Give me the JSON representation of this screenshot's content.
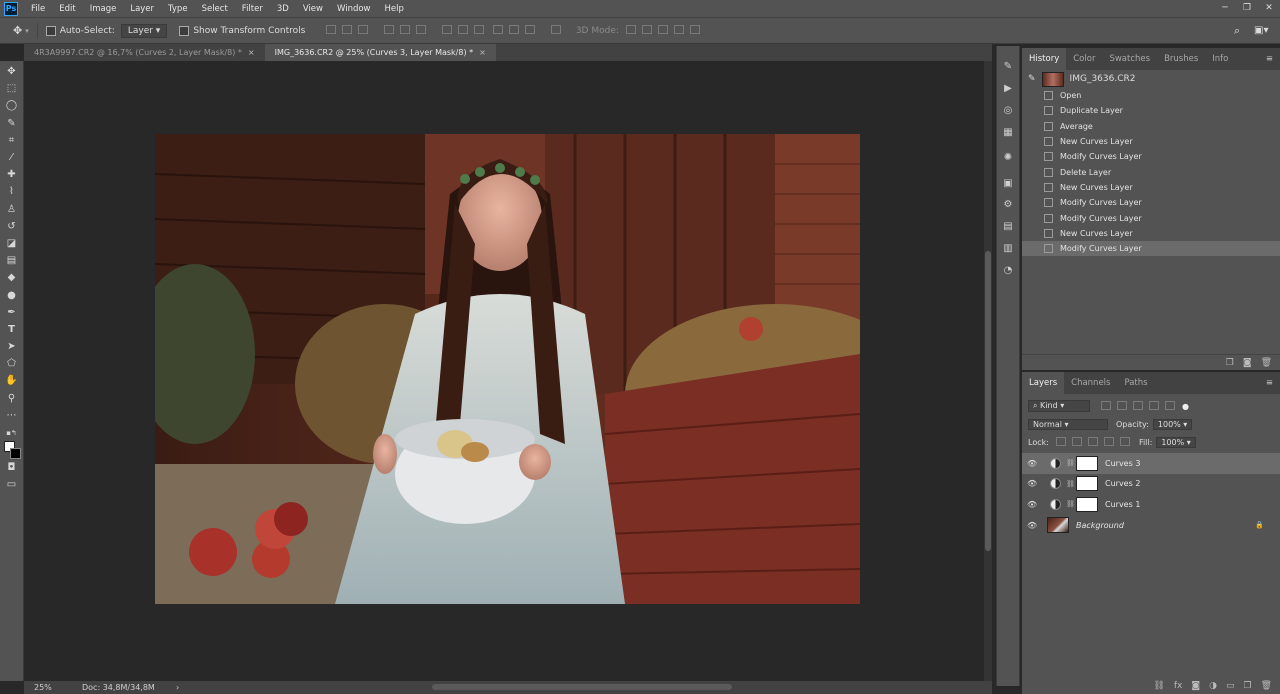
{
  "app": {
    "logo": "Ps"
  },
  "menubar": {
    "items": [
      "File",
      "Edit",
      "Image",
      "Layer",
      "Type",
      "Select",
      "Filter",
      "3D",
      "View",
      "Window",
      "Help"
    ]
  },
  "window_controls": {
    "minimize": "─",
    "maximize": "❐",
    "close": "✕"
  },
  "options_bar": {
    "auto_select_label": "Auto-Select:",
    "auto_select_target": "Layer",
    "transform_controls_label": "Show Transform Controls",
    "mode_3d_label": "3D Mode:"
  },
  "tabs": [
    {
      "label": "4R3A9997.CR2 @ 16,7% (Curves 2, Layer Mask/8) *",
      "close": "×"
    },
    {
      "label": "IMG_3636.CR2 @ 25% (Curves 3, Layer Mask/8) *",
      "close": "×"
    }
  ],
  "status": {
    "zoom": "25%",
    "doc": "Doc: 34,8M/34,8M",
    "arrow": "›"
  },
  "history_panel": {
    "tabs": [
      "History",
      "Color",
      "Swatches",
      "Brushes",
      "Info"
    ],
    "snapshot": "IMG_3636.CR2",
    "items": [
      "Open",
      "Duplicate Layer",
      "Average",
      "New Curves Layer",
      "Modify Curves Layer",
      "Delete Layer",
      "New Curves Layer",
      "Modify Curves Layer",
      "Modify Curves Layer",
      "New Curves Layer",
      "Modify Curves Layer"
    ],
    "selected_index": 10
  },
  "layers_panel": {
    "tabs": [
      "Layers",
      "Channels",
      "Paths"
    ],
    "filter_kind": "Kind",
    "blend_mode": "Normal",
    "opacity_label": "Opacity:",
    "opacity": "100%",
    "lock_label": "Lock:",
    "fill_label": "Fill:",
    "fill": "100%",
    "layers": [
      {
        "name": "Curves 3",
        "type": "curves",
        "active": true
      },
      {
        "name": "Curves 2",
        "type": "curves",
        "active": false
      },
      {
        "name": "Curves 1",
        "type": "curves",
        "active": false
      },
      {
        "name": "Background",
        "type": "background",
        "active": false
      }
    ],
    "footer_icons": [
      "link-icon",
      "fx-icon",
      "mask-icon",
      "adjustment-icon",
      "group-icon",
      "new-layer-icon",
      "trash-icon"
    ]
  },
  "colors": {
    "ui": "#535353",
    "canvas": "#282828",
    "accent": "#31a8ff"
  }
}
